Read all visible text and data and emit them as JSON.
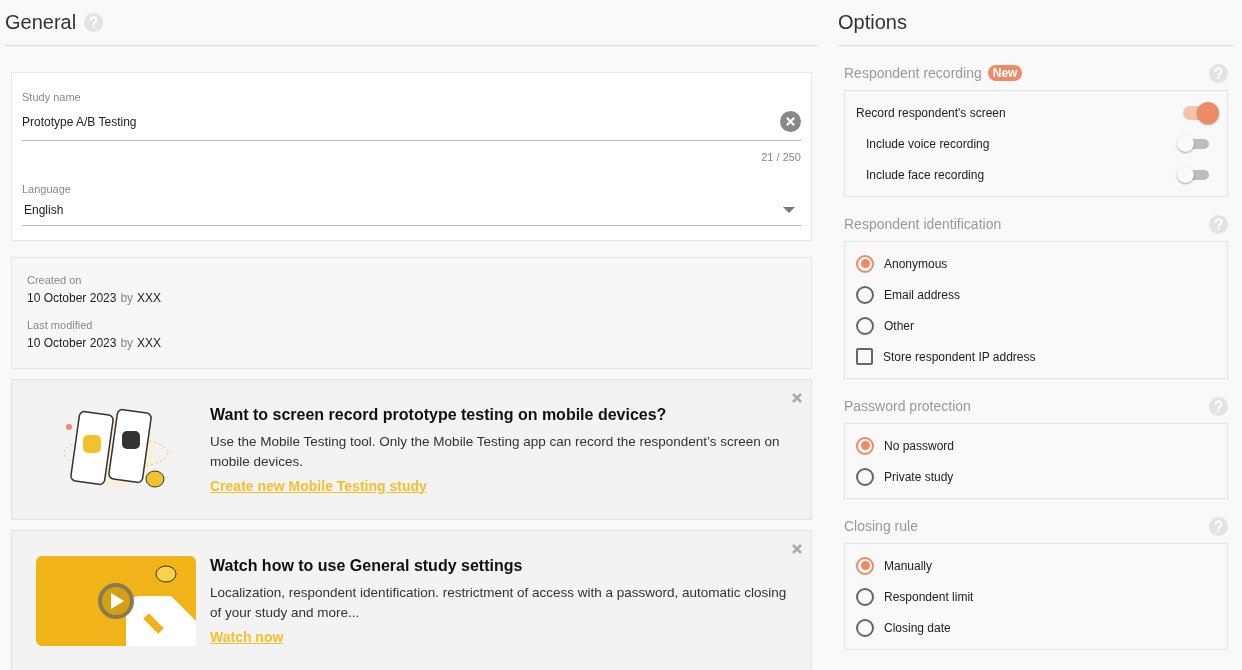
{
  "general": {
    "title": "General",
    "fields": [
      {
        "kind": "text",
        "label": "Study name",
        "value": "Prototype A/B Testing",
        "counter": "21 / 250"
      },
      {
        "kind": "select",
        "label": "Language",
        "value": "English"
      }
    ],
    "meta": [
      {
        "label": "Created on",
        "date": "10 October 2023",
        "by": "by",
        "author": "XXX"
      },
      {
        "label": "Last modified",
        "date": "10 October 2023",
        "by": "by",
        "author": "XXX"
      }
    ],
    "promos": [
      {
        "kind": "phones",
        "title": "Want to screen record prototype testing on mobile devices?",
        "body": "Use the Mobile Testing tool. Only the Mobile Testing app can record the respondent’s screen on mobile devices.",
        "link": "Create new Mobile Testing study"
      },
      {
        "kind": "video",
        "title": "Watch how to use General study settings",
        "body": "Localization, respondent identification. restrictment of access with a password, automatic closing of your study and more...",
        "link": "Watch now"
      }
    ]
  },
  "options": {
    "title": "Options",
    "sections": [
      {
        "title": "Respondent recording",
        "badge": "New",
        "items": [
          {
            "kind": "toggle",
            "label": "Record respondent's screen",
            "on": true,
            "children": [
              {
                "kind": "toggle",
                "label": "Include voice recording",
                "on": false
              },
              {
                "kind": "toggle",
                "label": "Include face recording",
                "on": false
              }
            ]
          }
        ]
      },
      {
        "title": "Respondent identification",
        "items": [
          {
            "kind": "radio",
            "label": "Anonymous",
            "selected": true
          },
          {
            "kind": "radio",
            "label": "Email address",
            "selected": false
          },
          {
            "kind": "radio",
            "label": "Other",
            "selected": false
          },
          {
            "kind": "checkbox",
            "label": "Store respondent IP address",
            "checked": false
          }
        ]
      },
      {
        "title": "Password protection",
        "items": [
          {
            "kind": "radio",
            "label": "No password",
            "selected": true
          },
          {
            "kind": "radio",
            "label": "Private study",
            "selected": false
          }
        ]
      },
      {
        "title": "Closing rule",
        "items": [
          {
            "kind": "radio",
            "label": "Manually",
            "selected": true
          },
          {
            "kind": "radio",
            "label": "Respondent limit",
            "selected": false
          },
          {
            "kind": "radio",
            "label": "Closing date",
            "selected": false
          }
        ]
      }
    ]
  }
}
